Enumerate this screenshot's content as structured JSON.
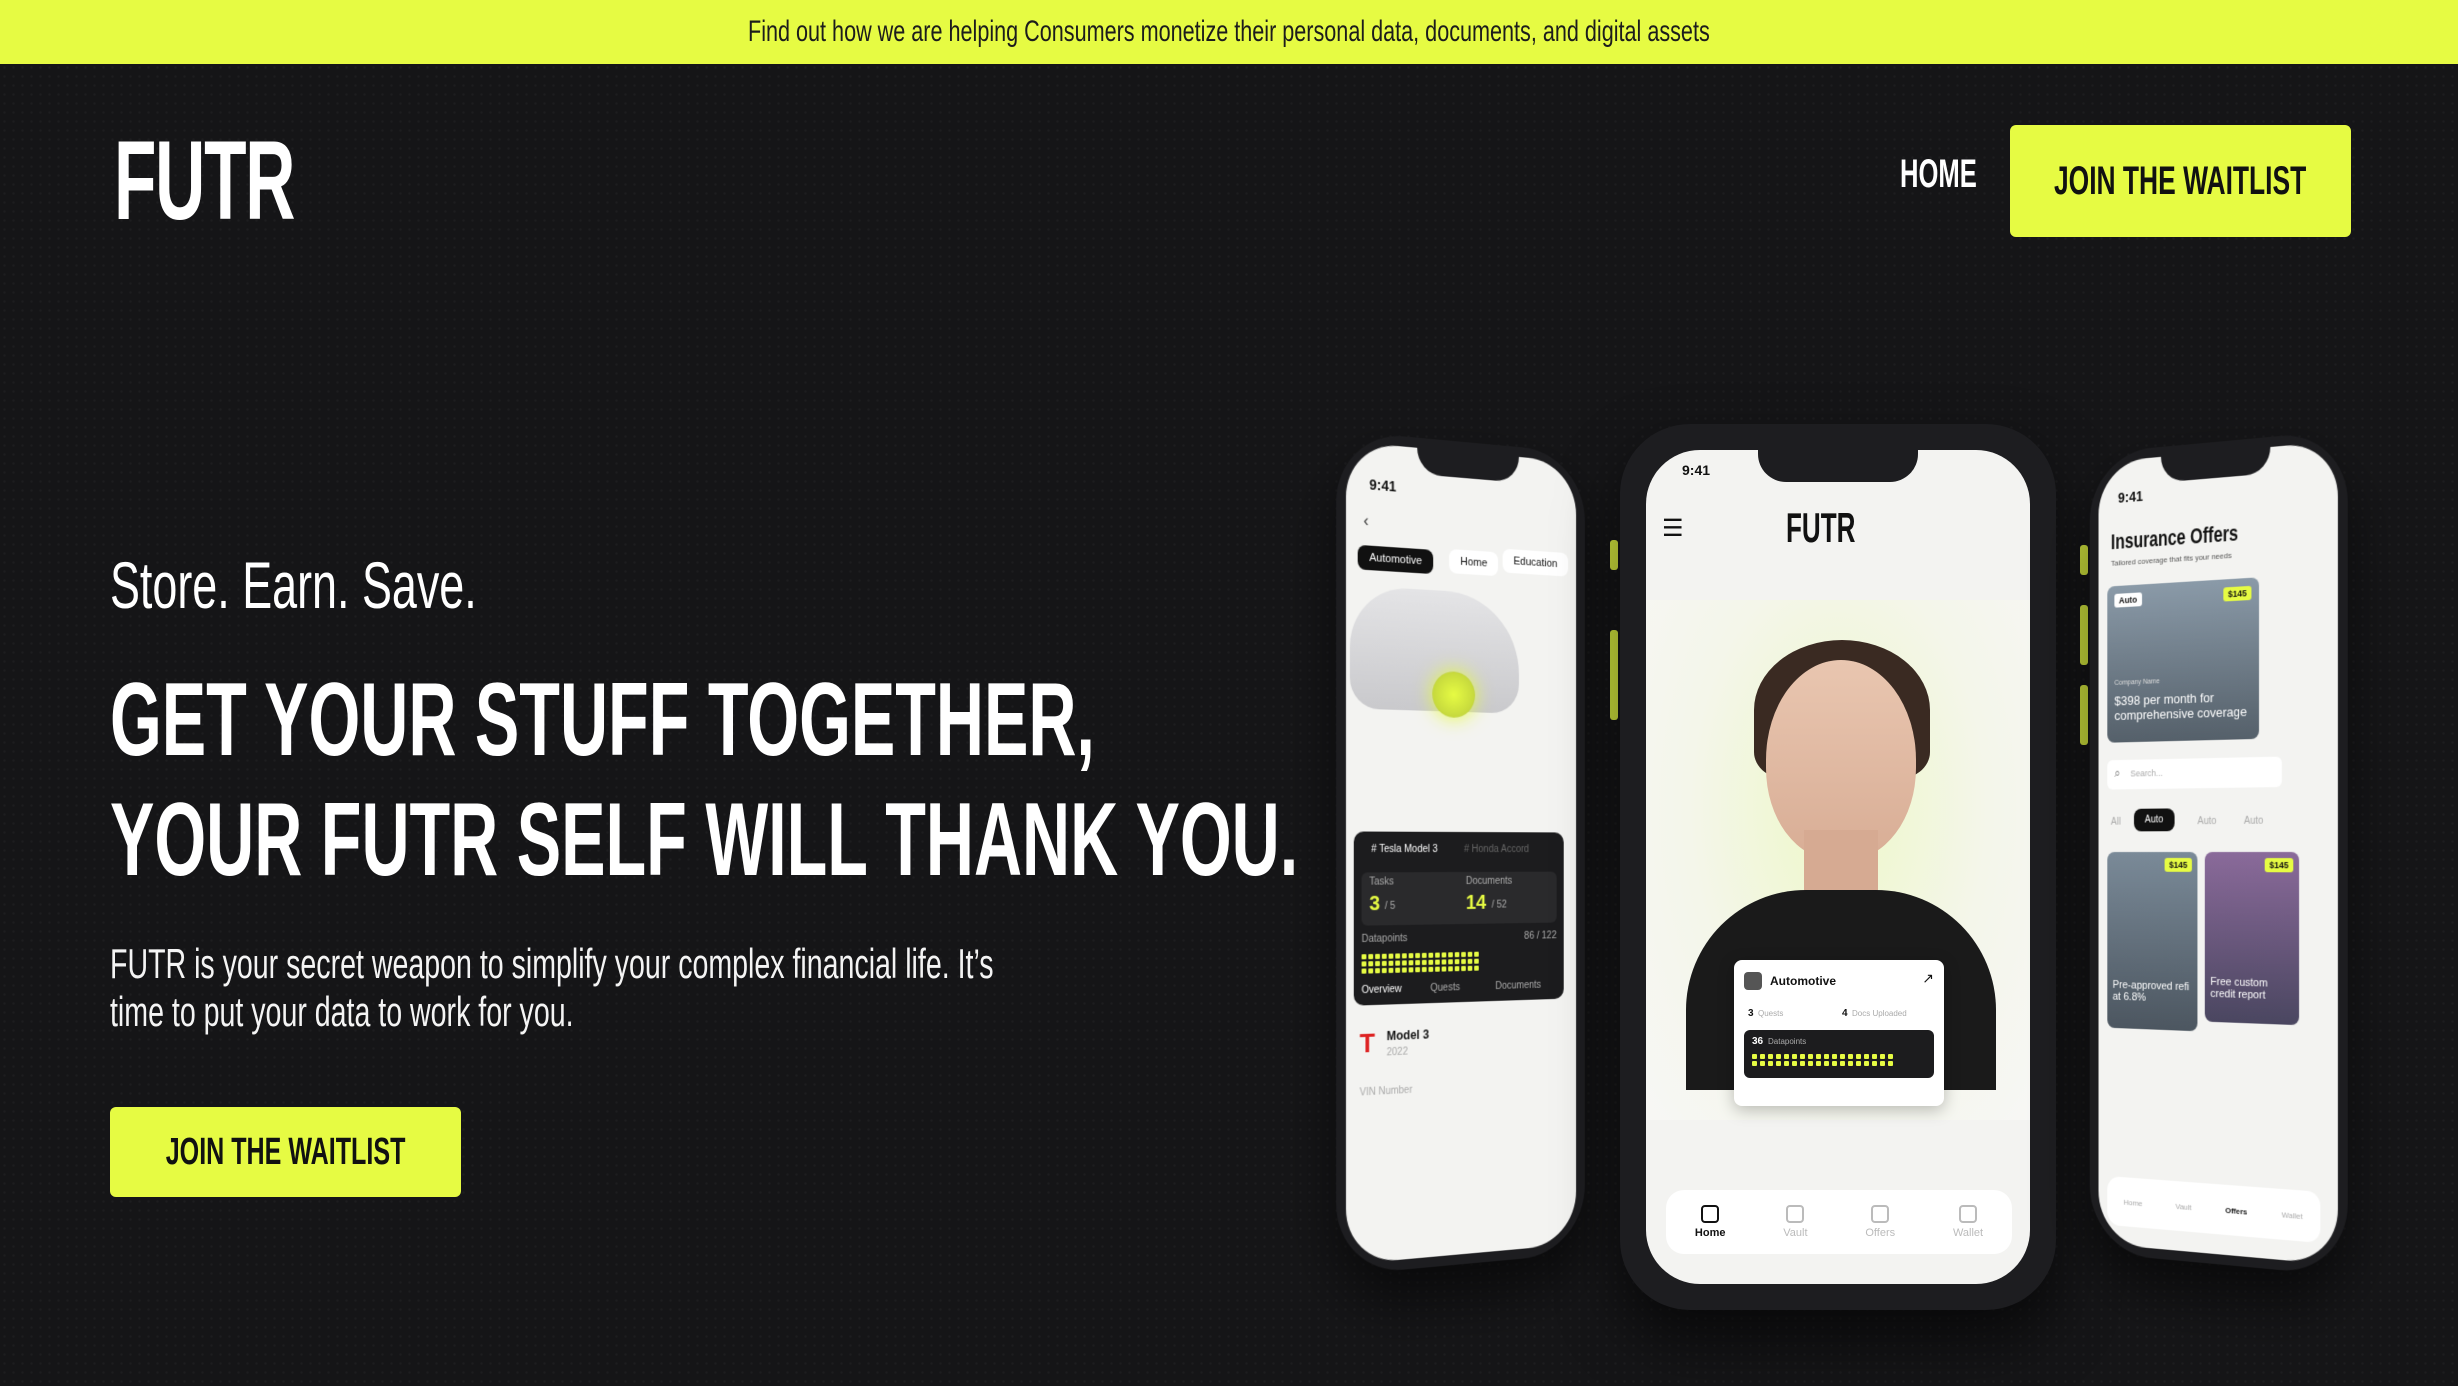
{
  "banner": {
    "text": "Find out how we are helping Consumers monetize their personal data, documents, and digital assets"
  },
  "header": {
    "logo_text": "FUTR",
    "nav_home": "HOME",
    "cta": "JOIN THE WAITLIST"
  },
  "hero": {
    "tagline": "Store. Earn. Save.",
    "headline_line1": "GET YOUR STUFF TOGETHER,",
    "headline_line2": "YOUR FUTR SELF WILL THANK YOU.",
    "description_line1": "FUTR is your secret weapon to simplify your complex financial life. It’s",
    "description_line2": "time to put your data to work for you.",
    "cta": "JOIN THE WAITLIST"
  },
  "phone_left": {
    "time": "9:41",
    "tabs": [
      "Automotive",
      "Home",
      "Education"
    ],
    "vehicle_tabs": [
      "# Tesla Model 3",
      "# Honda Accord"
    ],
    "tasks_label": "Tasks",
    "tasks_value": "3",
    "tasks_total": "/ 5",
    "documents_label": "Documents",
    "documents_value": "14",
    "documents_total": "/ 52",
    "datapoints_label": "Datapoints",
    "datapoints_value": "86 / 122",
    "bottom_tabs": [
      "Overview",
      "Quests",
      "Documents"
    ],
    "model_name": "Model 3",
    "model_year": "2022",
    "vin_label": "VIN Number"
  },
  "phone_center": {
    "time": "9:41",
    "logo_text": "FUTR",
    "card_title": "Automotive",
    "quests_value": "3",
    "quests_label": "Quests",
    "docs_value": "4",
    "docs_label": "Docs Uploaded",
    "datapoints_value": "36",
    "datapoints_label": "Datapoints",
    "tabbar": [
      "Home",
      "Vault",
      "Offers",
      "Wallet"
    ]
  },
  "phone_right": {
    "time": "9:41",
    "title": "Insurance Offers",
    "subtitle": "Tailored coverage that fits your needs",
    "offer1_tag": "Auto",
    "offer1_price": "$145",
    "offer1_company": "Company Name",
    "offer1_text": "$398 per month for comprehensive coverage",
    "search_placeholder": "Search...",
    "filters": [
      "All",
      "Auto",
      "Auto",
      "Auto"
    ],
    "offer2_text": "Pre-approved refi at 6.8%",
    "offer3_text": "Free custom credit report",
    "tabbar": [
      "Home",
      "Vault",
      "Offers",
      "Wallet"
    ]
  },
  "colors": {
    "accent": "#e6fb43",
    "background": "#151517"
  }
}
